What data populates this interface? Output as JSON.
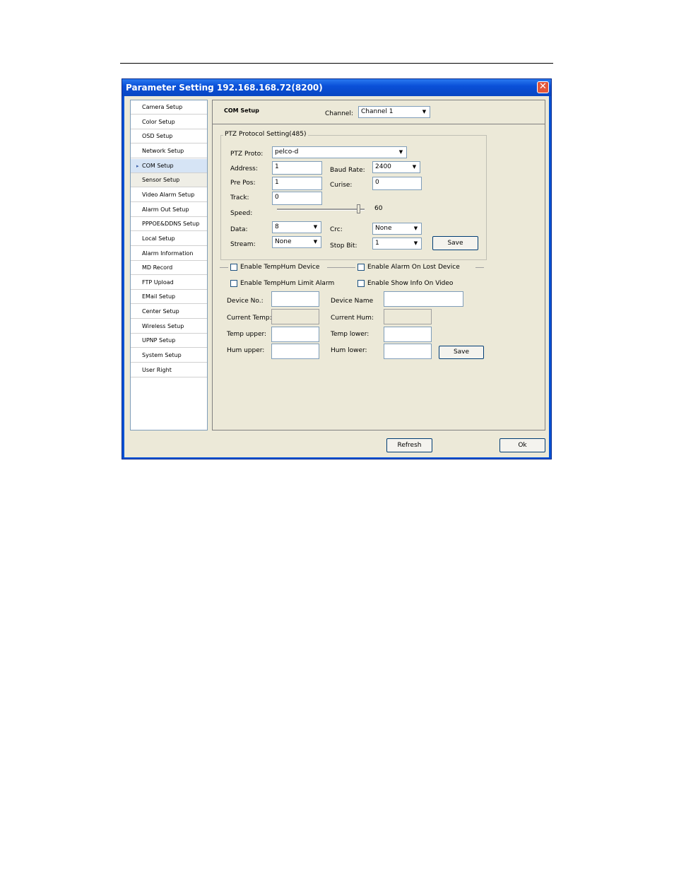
{
  "window": {
    "title": "Parameter Setting 192.168.168.72(8200)",
    "close_glyph": "✕"
  },
  "sidebar": {
    "items": [
      {
        "label": "Camera Setup"
      },
      {
        "label": "Color Setup"
      },
      {
        "label": "OSD Setup"
      },
      {
        "label": "Network Setup"
      },
      {
        "label": "COM Setup",
        "active": true
      },
      {
        "label": "Sensor Setup"
      },
      {
        "label": "Video Alarm Setup"
      },
      {
        "label": "Alarm Out Setup"
      },
      {
        "label": "PPPOE&DDNS Setup"
      },
      {
        "label": "Local Setup"
      },
      {
        "label": "Alarm Information"
      },
      {
        "label": "MD Record"
      },
      {
        "label": "FTP Upload"
      },
      {
        "label": "EMail Setup"
      },
      {
        "label": "Center Setup"
      },
      {
        "label": "Wireless Setup"
      },
      {
        "label": "UPNP Setup"
      },
      {
        "label": "System Setup"
      },
      {
        "label": "User Right"
      }
    ],
    "active_marker": "▸"
  },
  "header": {
    "section_title": "COM Setup",
    "channel_label": "Channel:",
    "channel_value": "Channel 1"
  },
  "ptz": {
    "legend": "PTZ Protocol Setting(485)",
    "proto_label": "PTZ Proto:",
    "proto_value": "pelco-d",
    "address_label": "Address:",
    "address_value": "1",
    "baud_label": "Baud Rate:",
    "baud_value": "2400",
    "prepos_label": "Pre Pos:",
    "prepos_value": "1",
    "cruise_label": "Curise:",
    "cruise_value": "0",
    "track_label": "Track:",
    "track_value": "0",
    "speed_label": "Speed:",
    "speed_value": "60",
    "data_label": "Data:",
    "data_value": "8",
    "crc_label": "Crc:",
    "crc_value": "None",
    "stream_label": "Stream:",
    "stream_value": "None",
    "stopbit_label": "Stop Bit:",
    "stopbit_value": "1",
    "save_label": "Save"
  },
  "temphum": {
    "enable_device_label": "Enable TempHum Device",
    "enable_alarm_lost_label": "Enable Alarm On Lost Device",
    "enable_limit_alarm_label": "Enable TempHum Limit Alarm",
    "enable_show_info_label": "Enable Show Info On Video",
    "device_no_label": "Device No.:",
    "device_no_value": "",
    "device_name_label": "Device Name",
    "device_name_value": "",
    "current_temp_label": "Current Temp:",
    "current_temp_value": "",
    "current_hum_label": "Current Hum:",
    "current_hum_value": "",
    "temp_upper_label": "Temp upper:",
    "temp_upper_value": "",
    "temp_lower_label": "Temp lower:",
    "temp_lower_value": "",
    "hum_upper_label": "Hum upper:",
    "hum_upper_value": "",
    "hum_lower_label": "Hum lower:",
    "hum_lower_value": "",
    "save_label": "Save"
  },
  "footer": {
    "refresh_label": "Refresh",
    "ok_label": "Ok"
  },
  "dropdown_arrow": "▼"
}
